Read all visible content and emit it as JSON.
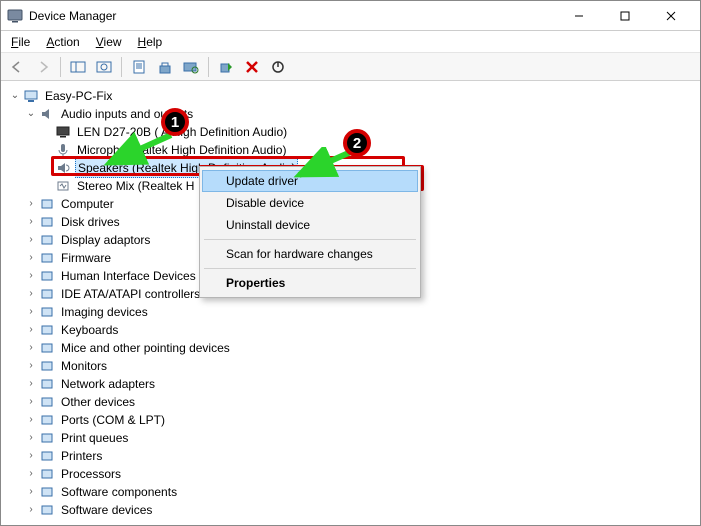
{
  "window": {
    "title": "Device Manager"
  },
  "menu": {
    "file": "File",
    "action": "Action",
    "view": "View",
    "help": "Help"
  },
  "tree": {
    "root": "Easy-PC-Fix",
    "audio": {
      "label": "Audio inputs and outputs",
      "children": {
        "len": "LEN D27-20B (NVIDIA High Definition Audio)",
        "mic": "Microphone (Realtek High Definition Audio)",
        "speakers": "Speakers (Realtek High Definition Audio)",
        "stereo": "Stereo Mix (Realtek High Definition Audio)"
      }
    },
    "categories": [
      "Computer",
      "Disk drives",
      "Display adaptors",
      "Firmware",
      "Human Interface Devices",
      "IDE ATA/ATAPI controllers",
      "Imaging devices",
      "Keyboards",
      "Mice and other pointing devices",
      "Monitors",
      "Network adapters",
      "Other devices",
      "Ports (COM & LPT)",
      "Print queues",
      "Printers",
      "Processors",
      "Software components",
      "Software devices"
    ]
  },
  "context_menu": {
    "update": "Update driver",
    "disable": "Disable device",
    "uninstall": "Uninstall device",
    "scan": "Scan for hardware changes",
    "properties": "Properties"
  },
  "annotations": {
    "step1": "1",
    "step2": "2"
  }
}
